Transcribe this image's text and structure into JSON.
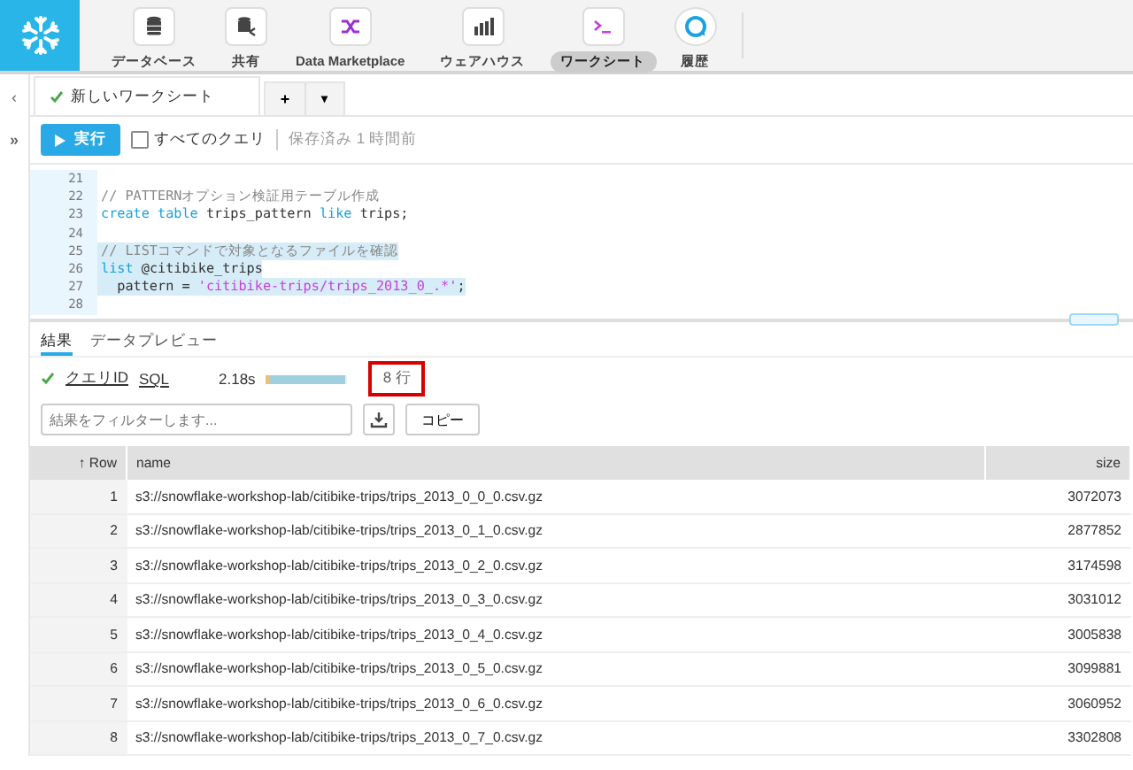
{
  "nav": [
    {
      "kind": "database",
      "label": "データベース",
      "selected": false
    },
    {
      "kind": "share",
      "label": "共有",
      "selected": false
    },
    {
      "kind": "marketplace",
      "label": "Data Marketplace",
      "selected": false
    },
    {
      "kind": "warehouse",
      "label": "ウェアハウス",
      "selected": false
    },
    {
      "kind": "worksheet",
      "label": "ワークシート",
      "selected": true
    },
    {
      "kind": "history",
      "label": "履歴",
      "selected": false
    }
  ],
  "sidebar": {
    "collapse": "‹",
    "expand": "»"
  },
  "worksheet_tab": {
    "title": "新しいワークシート",
    "add": "+",
    "menu": "▾"
  },
  "toolbar": {
    "run": "実行",
    "all_queries": {
      "label": "すべてのクエリ",
      "checked": false
    },
    "saved": "保存済み 1 時間前"
  },
  "editor": {
    "lines": [
      {
        "number": "21"
      },
      {
        "number": "22",
        "highlighted": false,
        "tokens": [
          {
            "kind": "comment",
            "text": "// PATTERNオプション検証用テーブル作成"
          }
        ]
      },
      {
        "number": "23",
        "highlighted": false,
        "tokens": [
          {
            "kind": "keyword",
            "text": "create table"
          },
          {
            "kind": "plain",
            "text": " trips_pattern "
          },
          {
            "kind": "keyword",
            "text": "like"
          },
          {
            "kind": "plain",
            "text": " trips;"
          }
        ]
      },
      {
        "number": "24"
      },
      {
        "number": "25",
        "highlighted": true,
        "tokens": [
          {
            "kind": "comment",
            "text": "// LISTコマンドで対象となるファイルを確認"
          }
        ]
      },
      {
        "number": "26",
        "highlighted": true,
        "tokens": [
          {
            "kind": "keyword",
            "text": "list"
          },
          {
            "kind": "plain",
            "text": " @citibike_trips"
          }
        ]
      },
      {
        "number": "27",
        "highlighted": true,
        "tokens": [
          {
            "kind": "plain",
            "text": "  pattern = "
          },
          {
            "kind": "string",
            "text": "'citibike-trips/trips_2013_0_.*'"
          },
          {
            "kind": "plain",
            "text": ";"
          }
        ]
      },
      {
        "number": "28"
      }
    ]
  },
  "result_tabs": [
    {
      "label": "結果",
      "selected": true
    },
    {
      "label": "データプレビュー",
      "selected": false
    }
  ],
  "stats": {
    "query_id": "クエリID",
    "sql": "SQL",
    "duration": "2.18s",
    "level": 0.98,
    "rows": "8 行"
  },
  "filter": {
    "placeholder": "結果をフィルターします..."
  },
  "copy": "コピー",
  "table": {
    "sort_arrow": "↑",
    "columns": [
      "Row",
      "name",
      "size"
    ],
    "rows": [
      [
        "1",
        "s3://snowflake-workshop-lab/citibike-trips/trips_2013_0_0_0.csv.gz",
        "3072073"
      ],
      [
        "2",
        "s3://snowflake-workshop-lab/citibike-trips/trips_2013_0_1_0.csv.gz",
        "2877852"
      ],
      [
        "3",
        "s3://snowflake-workshop-lab/citibike-trips/trips_2013_0_2_0.csv.gz",
        "3174598"
      ],
      [
        "4",
        "s3://snowflake-workshop-lab/citibike-trips/trips_2013_0_3_0.csv.gz",
        "3031012"
      ],
      [
        "5",
        "s3://snowflake-workshop-lab/citibike-trips/trips_2013_0_4_0.csv.gz",
        "3005838"
      ],
      [
        "6",
        "s3://snowflake-workshop-lab/citibike-trips/trips_2013_0_5_0.csv.gz",
        "3099881"
      ],
      [
        "7",
        "s3://snowflake-workshop-lab/citibike-trips/trips_2013_0_6_0.csv.gz",
        "3060952"
      ],
      [
        "8",
        "s3://snowflake-workshop-lab/citibike-trips/trips_2013_0_7_0.csv.gz",
        "3302808"
      ]
    ]
  }
}
